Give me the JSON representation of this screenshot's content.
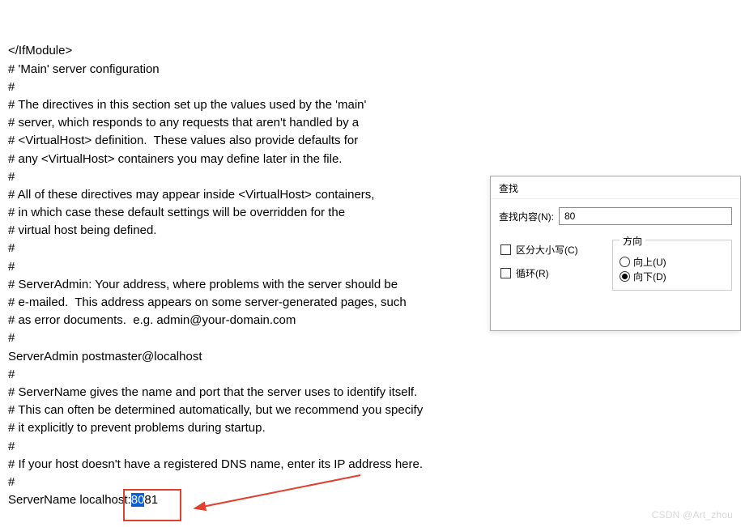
{
  "editor": {
    "lines": [
      "</IfModule>",
      "",
      "# 'Main' server configuration",
      "#",
      "# The directives in this section set up the values used by the 'main'",
      "# server, which responds to any requests that aren't handled by a",
      "# <VirtualHost> definition.  These values also provide defaults for",
      "# any <VirtualHost> containers you may define later in the file.",
      "#",
      "# All of these directives may appear inside <VirtualHost> containers,",
      "# in which case these default settings will be overridden for the",
      "# virtual host being defined.",
      "#",
      "",
      "#",
      "# ServerAdmin: Your address, where problems with the server should be",
      "# e-mailed.  This address appears on some server-generated pages, such",
      "# as error documents.  e.g. admin@your-domain.com",
      "#",
      "ServerAdmin postmaster@localhost",
      "",
      "#",
      "# ServerName gives the name and port that the server uses to identify itself.",
      "# This can often be determined automatically, but we recommend you specify",
      "# it explicitly to prevent problems during startup.",
      "#",
      "# If your host doesn't have a registered DNS name, enter its IP address here.",
      "#"
    ],
    "last_line": {
      "prefix": "ServerName localhost:",
      "selected": "80",
      "suffix": "81"
    }
  },
  "find": {
    "title": "查找",
    "search_label": "查找内容(N):",
    "search_value": "80",
    "match_case": "区分大小写(C)",
    "loop": "循环(R)",
    "direction_label": "方向",
    "up_label": "向上(U)",
    "down_label": "向下(D)"
  },
  "watermark": "CSDN @Art_zhou"
}
